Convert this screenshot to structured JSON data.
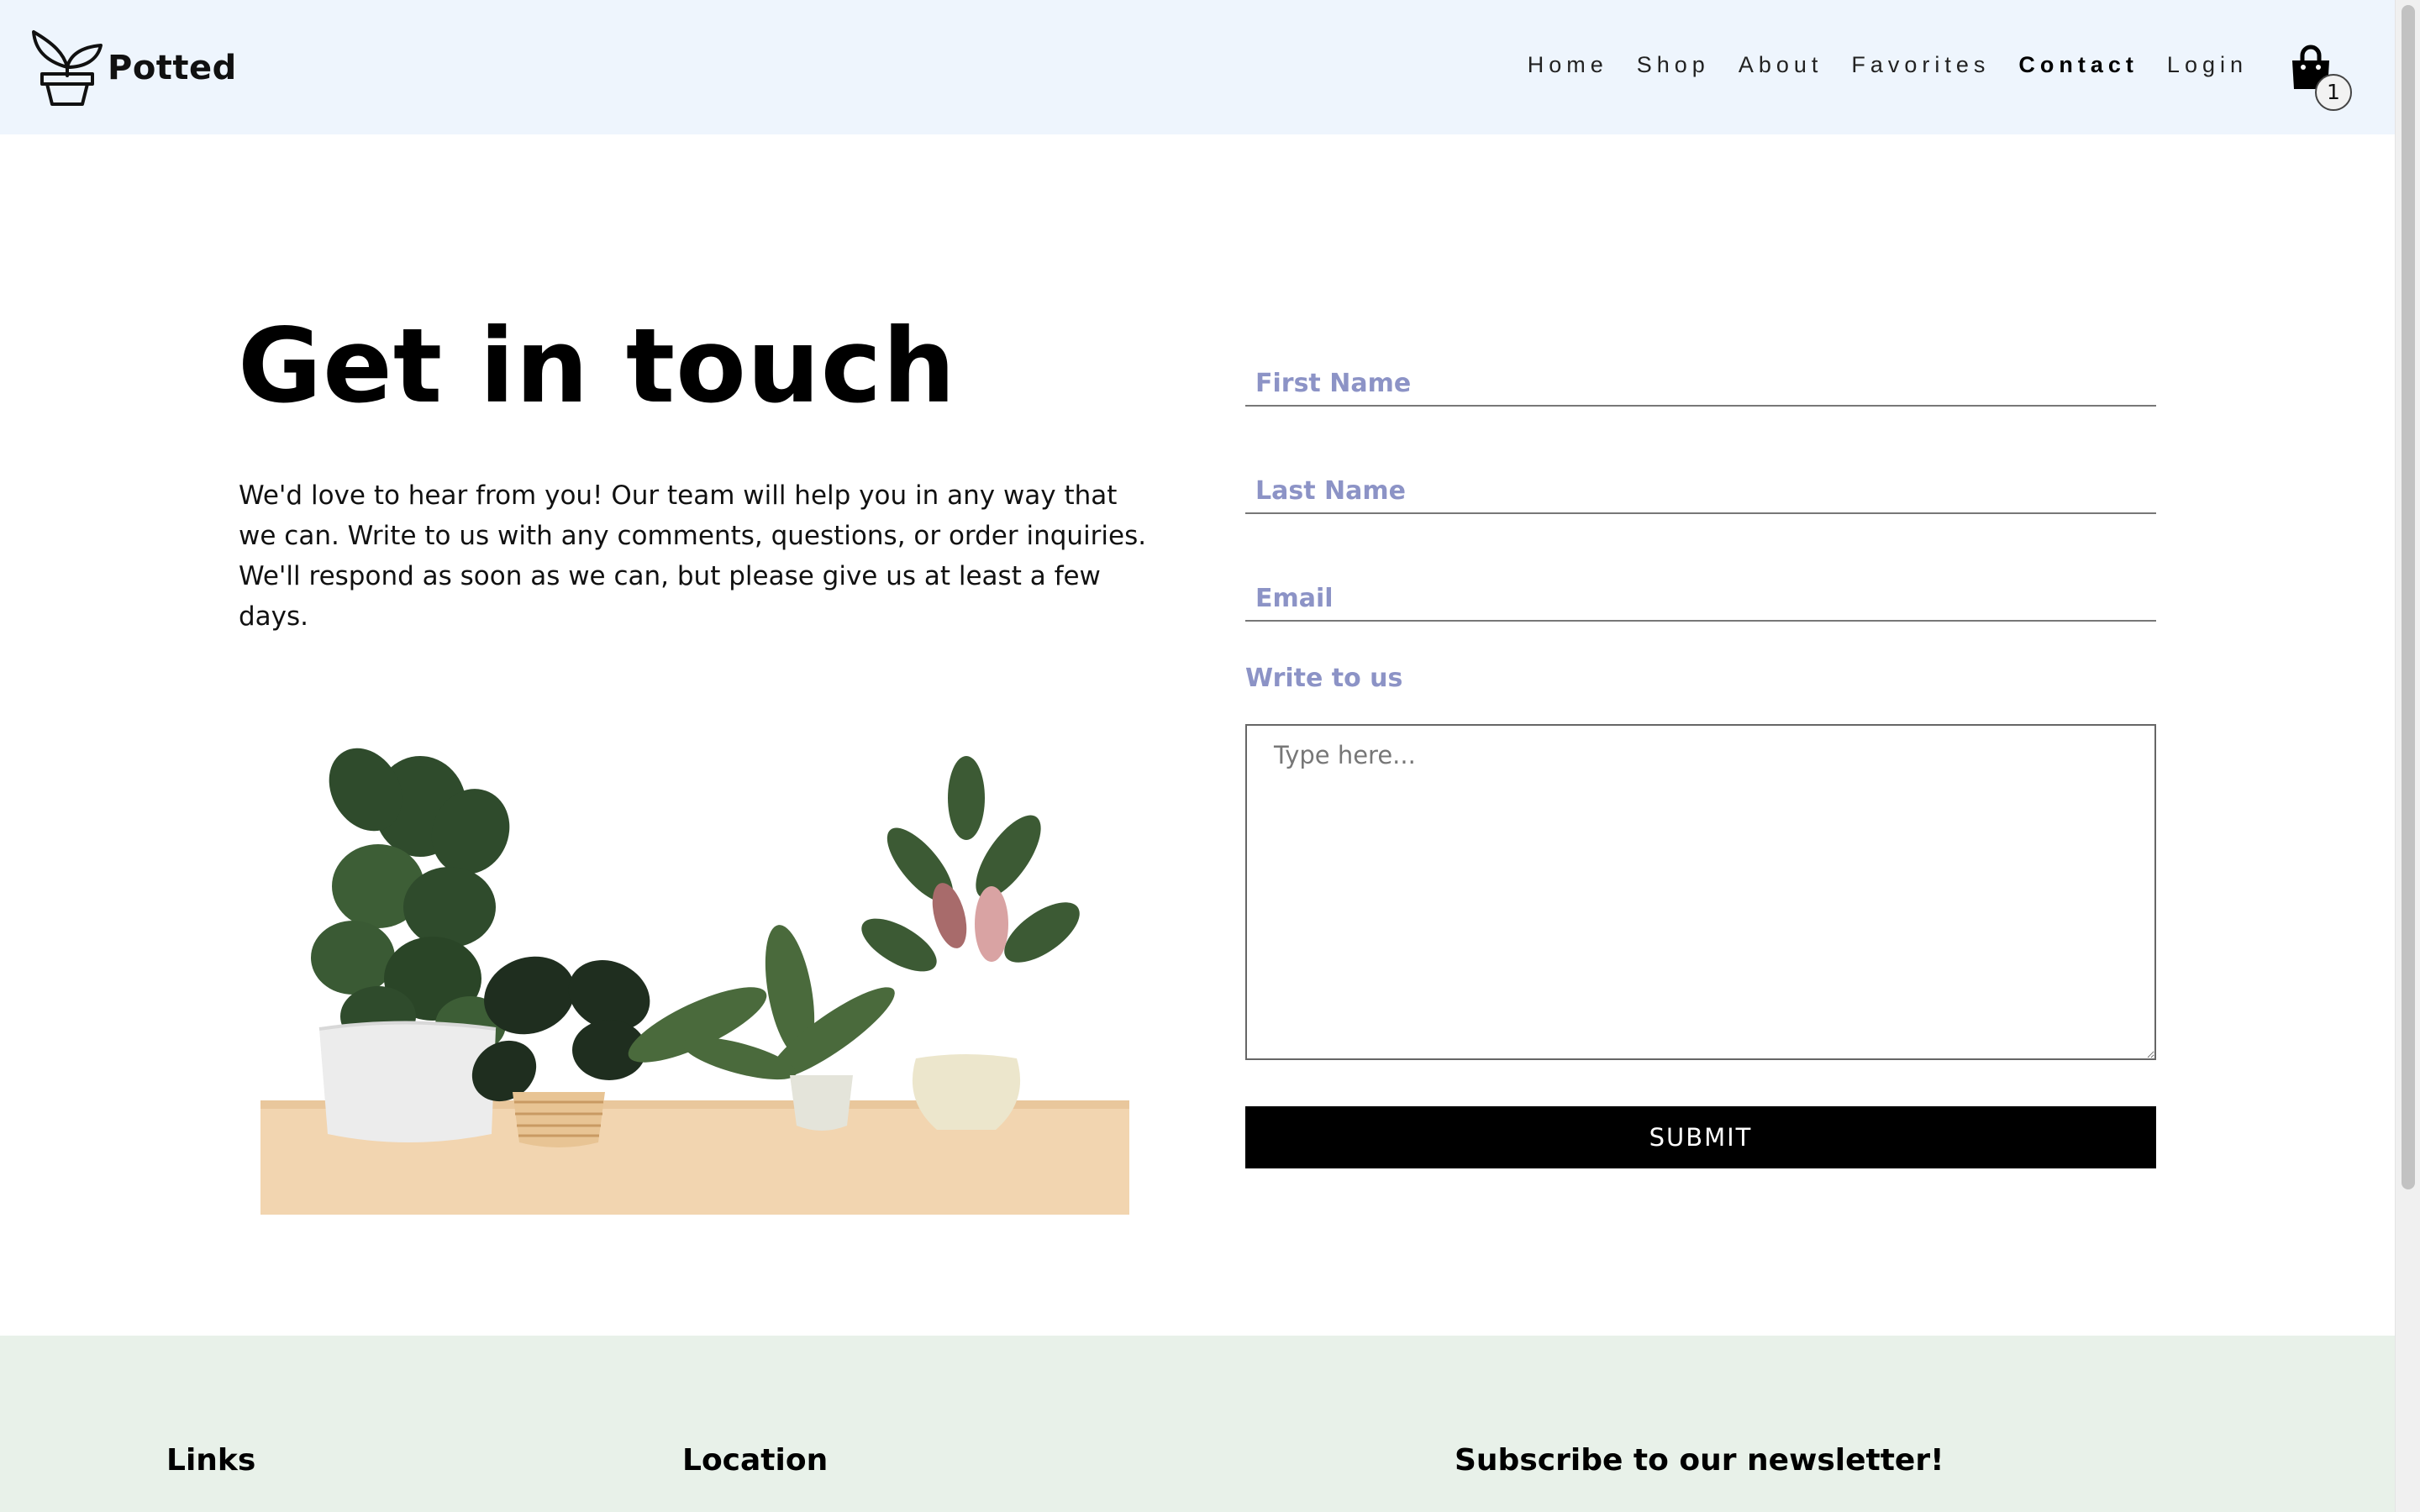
{
  "brand": {
    "name": "Potted",
    "logo_icon": "potted-plant-icon"
  },
  "nav": {
    "items": [
      {
        "label": "Home",
        "active": false
      },
      {
        "label": "Shop",
        "active": false
      },
      {
        "label": "About",
        "active": false
      },
      {
        "label": "Favorites",
        "active": false
      },
      {
        "label": "Contact",
        "active": true
      },
      {
        "label": "Login",
        "active": false
      }
    ]
  },
  "cart": {
    "icon": "shopping-bag-icon",
    "count": "1"
  },
  "main": {
    "heading": "Get in touch",
    "intro": "We'd love to hear from you! Our team will help you in any way that we can. Write to us with any comments, questions, or order inquiries. We'll respond as soon as we can, but please give us at least a few days."
  },
  "form": {
    "first_name": {
      "placeholder": "First Name",
      "value": ""
    },
    "last_name": {
      "placeholder": "Last Name",
      "value": ""
    },
    "email": {
      "placeholder": "Email",
      "value": ""
    },
    "message_label": "Write to us",
    "message": {
      "placeholder": "Type here...",
      "value": ""
    },
    "submit_label": "SUBMIT"
  },
  "footer": {
    "links_heading": "Links",
    "location_heading": "Location",
    "newsletter_heading": "Subscribe to our newsletter!"
  },
  "colors": {
    "header_bg": "#eef5fd",
    "footer_bg": "#e8f1e9",
    "placeholder": "#8c93c6",
    "button_bg": "#000000"
  }
}
